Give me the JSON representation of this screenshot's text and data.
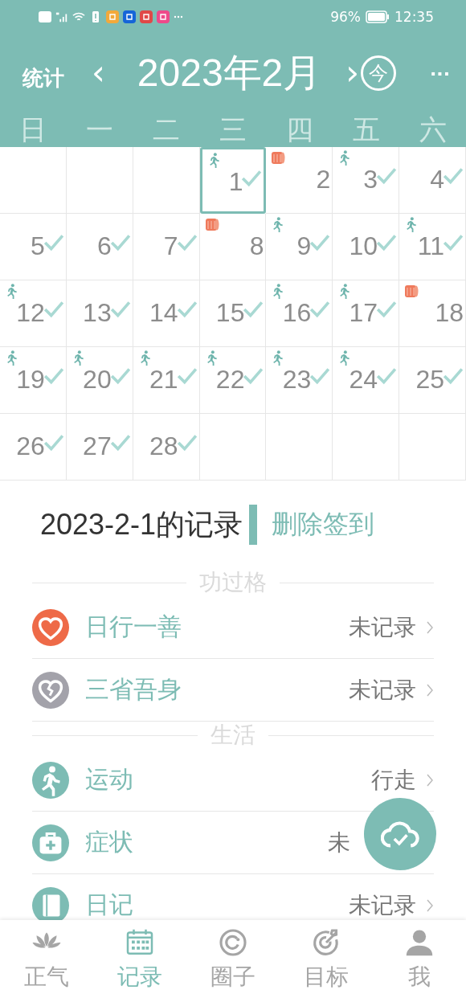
{
  "status_bar": {
    "battery": "96%",
    "time": "12:35"
  },
  "header": {
    "left": "统计",
    "prev": "‹",
    "title": "2023年2月",
    "next": "›",
    "today": "今",
    "more": "···"
  },
  "weekdays": [
    "日",
    "一",
    "二",
    "三",
    "四",
    "五",
    "六"
  ],
  "calendar": {
    "days": [
      {
        "kind": "blank"
      },
      {
        "kind": "blank"
      },
      {
        "kind": "blank"
      },
      {
        "kind": "run",
        "day": "1",
        "checked": true,
        "selected": true
      },
      {
        "kind": "roll",
        "day": "2",
        "checked": false,
        "selected": false
      },
      {
        "kind": "run",
        "day": "3",
        "checked": true,
        "selected": false
      },
      {
        "kind": "plain",
        "day": "4",
        "checked": true,
        "selected": false
      },
      {
        "kind": "plain",
        "day": "5",
        "checked": true,
        "selected": false
      },
      {
        "kind": "plain",
        "day": "6",
        "checked": true,
        "selected": false
      },
      {
        "kind": "plain",
        "day": "7",
        "checked": true,
        "selected": false
      },
      {
        "kind": "roll",
        "day": "8",
        "checked": false,
        "selected": false
      },
      {
        "kind": "run",
        "day": "9",
        "checked": true,
        "selected": false
      },
      {
        "kind": "plain",
        "day": "10",
        "checked": true,
        "selected": false
      },
      {
        "kind": "run",
        "day": "11",
        "checked": true,
        "selected": false
      },
      {
        "kind": "run",
        "day": "12",
        "checked": true,
        "selected": false
      },
      {
        "kind": "plain",
        "day": "13",
        "checked": true,
        "selected": false
      },
      {
        "kind": "plain",
        "day": "14",
        "checked": true,
        "selected": false
      },
      {
        "kind": "plain",
        "day": "15",
        "checked": true,
        "selected": false
      },
      {
        "kind": "run",
        "day": "16",
        "checked": true,
        "selected": false
      },
      {
        "kind": "run",
        "day": "17",
        "checked": true,
        "selected": false
      },
      {
        "kind": "roll",
        "day": "18",
        "checked": false,
        "selected": false
      },
      {
        "kind": "run",
        "day": "19",
        "checked": true,
        "selected": false
      },
      {
        "kind": "run",
        "day": "20",
        "checked": true,
        "selected": false
      },
      {
        "kind": "run",
        "day": "21",
        "checked": true,
        "selected": false
      },
      {
        "kind": "run",
        "day": "22",
        "checked": true,
        "selected": false
      },
      {
        "kind": "run",
        "day": "23",
        "checked": true,
        "selected": false
      },
      {
        "kind": "run",
        "day": "24",
        "checked": true,
        "selected": false
      },
      {
        "kind": "plain",
        "day": "25",
        "checked": true,
        "selected": false
      },
      {
        "kind": "plain",
        "day": "26",
        "checked": true,
        "selected": false
      },
      {
        "kind": "plain",
        "day": "27",
        "checked": true,
        "selected": false
      },
      {
        "kind": "plain",
        "day": "28",
        "checked": true,
        "selected": false
      },
      {
        "kind": "blank"
      },
      {
        "kind": "blank"
      },
      {
        "kind": "blank"
      },
      {
        "kind": "blank"
      }
    ]
  },
  "record": {
    "title": "2023-2-1的记录",
    "delete": "删除签到"
  },
  "sections": [
    {
      "title": "功过格",
      "items": [
        {
          "kind": "heart",
          "color": "#ee6a48",
          "label": "日行一善",
          "value": "未记录"
        },
        {
          "kind": "broken-heart",
          "color": "#a3a2aa",
          "label": "三省吾身",
          "value": "未记录"
        }
      ]
    },
    {
      "title": "生活",
      "items": [
        {
          "kind": "run",
          "color": "#7dbcb4",
          "label": "运动",
          "value": "行走"
        },
        {
          "kind": "medkit",
          "color": "#7dbcb4",
          "label": "症状",
          "value": "未",
          "covered": true
        },
        {
          "kind": "book",
          "color": "#7dbcb4",
          "label": "日记",
          "value": "未记录"
        }
      ]
    }
  ],
  "nav": [
    {
      "kind": "lotus",
      "label": "正气",
      "selected": false
    },
    {
      "kind": "calendar",
      "label": "记录",
      "selected": true
    },
    {
      "kind": "ring",
      "label": "圈子",
      "selected": false
    },
    {
      "kind": "target",
      "label": "目标",
      "selected": false
    },
    {
      "kind": "person",
      "label": "我",
      "selected": false
    }
  ]
}
